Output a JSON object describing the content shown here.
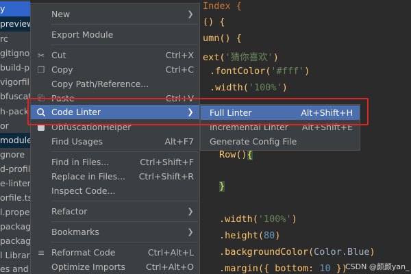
{
  "tree": {
    "rows": [
      {
        "label": "y",
        "style": "sel2"
      },
      {
        "label": "preview",
        "style": "sel"
      },
      {
        "label": "rc",
        "style": ""
      },
      {
        "label": "gitignor",
        "style": ""
      },
      {
        "label": "build-pr",
        "style": ""
      },
      {
        "label": "vigorfil",
        "style": ""
      },
      {
        "label": "bfuscat",
        "style": ""
      },
      {
        "label": "h-pack",
        "style": ""
      },
      {
        "label": "or",
        "style": ""
      },
      {
        "label": "module",
        "style": "sel"
      },
      {
        "label": "gnore",
        "style": ""
      },
      {
        "label": "d-profil",
        "style": ""
      },
      {
        "label": "e-linter.",
        "style": ""
      },
      {
        "label": "orfile.ts",
        "style": ""
      },
      {
        "label": "l.prope",
        "style": ""
      },
      {
        "label": "packag",
        "style": ""
      },
      {
        "label": "packag",
        "style": ""
      },
      {
        "label": "l Librar",
        "style": ""
      },
      {
        "label": "es and",
        "style": ""
      }
    ]
  },
  "editor": {
    "lines": {
      "l1": "Index {",
      "l2": "() {",
      "l3": "umn() {",
      "l4a": "ext(",
      "l4b": "'猜你喜欢'",
      "l4c": ")",
      "l5a": ".fontColor(",
      "l5b": "'#fff'",
      "l5c": ")",
      "l6a": ".width(",
      "l6b": "'100%'",
      "l6c": ")",
      "l7": "Row()",
      "l7b": "{",
      "l8": "}",
      "l9a": ".width(",
      "l9b": "'100%'",
      "l9c": ")",
      "l10a": ".height(",
      "l10b": "80",
      "l10c": ")",
      "l11a": ".backgroundColor(",
      "l11b": "Color.Blue",
      "l11c": ")",
      "l12a": ".margin({ bottom: ",
      "l12b": "10",
      "l12c": " })"
    }
  },
  "menu": {
    "new": {
      "label": "New",
      "icon": "",
      "shortcut": ""
    },
    "export_module": {
      "label": "Export Module"
    },
    "cut": {
      "label": "Cut",
      "icon": "scissors-icon",
      "shortcut": "Ctrl+X"
    },
    "copy": {
      "label": "Copy",
      "icon": "copy-icon",
      "shortcut": "Ctrl+C"
    },
    "copy_path": {
      "label": "Copy Path/Reference..."
    },
    "paste": {
      "label": "Paste",
      "icon": "paste-icon",
      "shortcut": "Ctrl+V"
    },
    "code_linter": {
      "label": "Code Linter",
      "icon": "linter-icon"
    },
    "obfuscation": {
      "label": "ObfuscationHelper",
      "icon": "obfuscation-icon"
    },
    "find_usages": {
      "label": "Find Usages",
      "shortcut": "Alt+F7"
    },
    "find_in_files": {
      "label": "Find in Files...",
      "shortcut": "Ctrl+Shift+F"
    },
    "replace_in_files": {
      "label": "Replace in Files...",
      "shortcut": "Ctrl+Shift+R"
    },
    "inspect_code": {
      "label": "Inspect Code..."
    },
    "refactor": {
      "label": "Refactor"
    },
    "bookmarks": {
      "label": "Bookmarks"
    },
    "reformat_code": {
      "label": "Reformat Code",
      "icon": "reformat-icon",
      "shortcut": "Ctrl+Alt+L"
    },
    "optimize_imports": {
      "label": "Optimize Imports",
      "shortcut": "Ctrl+Alt+O"
    }
  },
  "submenu": {
    "full_linter": {
      "label": "Full Linter",
      "shortcut": "Alt+Shift+H"
    },
    "incremental_linter": {
      "label": "Incremental Linter",
      "shortcut": "Alt+Shift+E"
    },
    "generate_config": {
      "label": "Generate Config File"
    }
  },
  "watermark": "CSDN @颜颜yan_",
  "colors": {
    "menu_bg": "#3c3f41",
    "selection": "#4b6eaf",
    "highlight_box": "#e02424"
  }
}
